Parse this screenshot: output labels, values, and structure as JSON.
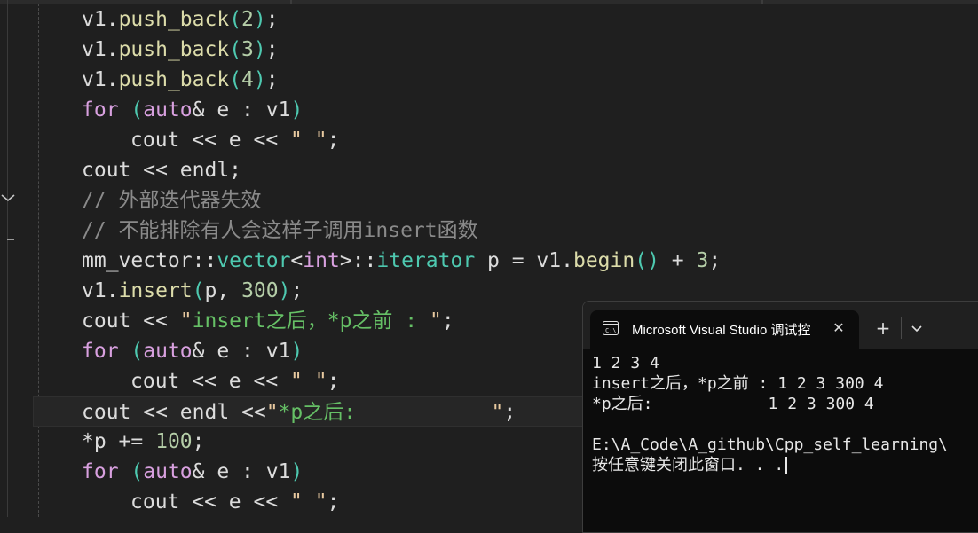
{
  "editor": {
    "lines": [
      {
        "indent": 1,
        "tokens": [
          [
            "v1",
            "c-text"
          ],
          [
            ".",
            "c-text"
          ],
          [
            "push_back",
            "c-fn"
          ],
          [
            "(",
            "c-paren"
          ],
          [
            "2",
            "c-num"
          ],
          [
            ")",
            "c-paren"
          ],
          [
            ";",
            "c-text"
          ]
        ]
      },
      {
        "indent": 1,
        "tokens": [
          [
            "v1",
            "c-text"
          ],
          [
            ".",
            "c-text"
          ],
          [
            "push_back",
            "c-fn"
          ],
          [
            "(",
            "c-paren"
          ],
          [
            "3",
            "c-num"
          ],
          [
            ")",
            "c-paren"
          ],
          [
            ";",
            "c-text"
          ]
        ]
      },
      {
        "indent": 1,
        "tokens": [
          [
            "v1",
            "c-text"
          ],
          [
            ".",
            "c-text"
          ],
          [
            "push_back",
            "c-fn"
          ],
          [
            "(",
            "c-paren"
          ],
          [
            "4",
            "c-num"
          ],
          [
            ")",
            "c-paren"
          ],
          [
            ";",
            "c-text"
          ]
        ]
      },
      {
        "indent": 1,
        "tokens": [
          [
            "for",
            "c-ctl"
          ],
          [
            " ",
            "c-text"
          ],
          [
            "(",
            "c-paren"
          ],
          [
            "auto",
            "c-kw"
          ],
          [
            "& e : v1",
            "c-text"
          ],
          [
            ")",
            "c-paren"
          ]
        ]
      },
      {
        "indent": 2,
        "tokens": [
          [
            "cout",
            "c-text"
          ],
          [
            " << e << ",
            "c-text"
          ],
          [
            "\" \"",
            "c-strq"
          ],
          [
            ";",
            "c-text"
          ]
        ]
      },
      {
        "indent": 1,
        "tokens": [
          [
            "cout",
            "c-text"
          ],
          [
            " << ",
            "c-text"
          ],
          [
            "endl",
            "c-text"
          ],
          [
            ";",
            "c-text"
          ]
        ]
      },
      {
        "indent": 1,
        "tokens": [
          [
            "// 外部迭代器失效",
            "c-cmt"
          ]
        ]
      },
      {
        "indent": 1,
        "tokens": [
          [
            "// 不能排除有人会这样子调用insert函数",
            "c-cmt"
          ]
        ]
      },
      {
        "indent": 1,
        "tokens": [
          [
            "mm_vector",
            "c-text"
          ],
          [
            "::",
            "c-text"
          ],
          [
            "vector",
            "c-type"
          ],
          [
            "<",
            "c-text"
          ],
          [
            "int",
            "c-kw"
          ],
          [
            ">",
            "c-text"
          ],
          [
            "::",
            "c-text"
          ],
          [
            "iterator",
            "c-type"
          ],
          [
            " p = ",
            "c-text"
          ],
          [
            "v1",
            "c-text"
          ],
          [
            ".",
            "c-text"
          ],
          [
            "begin",
            "c-fn"
          ],
          [
            "()",
            "c-paren"
          ],
          [
            " + ",
            "c-text"
          ],
          [
            "3",
            "c-num"
          ],
          [
            ";",
            "c-text"
          ]
        ]
      },
      {
        "indent": 1,
        "tokens": [
          [
            "v1",
            "c-text"
          ],
          [
            ".",
            "c-text"
          ],
          [
            "insert",
            "c-fn"
          ],
          [
            "(",
            "c-paren"
          ],
          [
            "p, ",
            "c-text"
          ],
          [
            "300",
            "c-num"
          ],
          [
            ")",
            "c-paren"
          ],
          [
            ";",
            "c-text"
          ]
        ]
      },
      {
        "indent": 1,
        "tokens": [
          [
            "cout",
            "c-text"
          ],
          [
            " << ",
            "c-text"
          ],
          [
            "\"",
            "c-strq"
          ],
          [
            "insert之后，*p之前 : ",
            "c-strg"
          ],
          [
            "\"",
            "c-strq"
          ],
          [
            ";",
            "c-text"
          ]
        ]
      },
      {
        "indent": 1,
        "tokens": [
          [
            "for",
            "c-ctl"
          ],
          [
            " ",
            "c-text"
          ],
          [
            "(",
            "c-paren"
          ],
          [
            "auto",
            "c-kw"
          ],
          [
            "& e : v1",
            "c-text"
          ],
          [
            ")",
            "c-paren"
          ]
        ]
      },
      {
        "indent": 2,
        "tokens": [
          [
            "cout",
            "c-text"
          ],
          [
            " << e << ",
            "c-text"
          ],
          [
            "\" \"",
            "c-strq"
          ],
          [
            ";",
            "c-text"
          ]
        ]
      },
      {
        "indent": 1,
        "current": true,
        "tokens": [
          [
            "cout",
            "c-text"
          ],
          [
            " << ",
            "c-text"
          ],
          [
            "endl",
            "c-text"
          ],
          [
            " <<",
            "c-text"
          ],
          [
            "\"",
            "c-strq"
          ],
          [
            "*p之后:           ",
            "c-strg"
          ],
          [
            "\"",
            "c-strq"
          ],
          [
            ";",
            "c-text"
          ]
        ]
      },
      {
        "indent": 1,
        "tokens": [
          [
            "*p",
            "c-text"
          ],
          [
            " += ",
            "c-text"
          ],
          [
            "100",
            "c-num"
          ],
          [
            ";",
            "c-text"
          ]
        ]
      },
      {
        "indent": 1,
        "tokens": [
          [
            "for",
            "c-ctl"
          ],
          [
            " ",
            "c-text"
          ],
          [
            "(",
            "c-paren"
          ],
          [
            "auto",
            "c-kw"
          ],
          [
            "& e : v1",
            "c-text"
          ],
          [
            ")",
            "c-paren"
          ]
        ]
      },
      {
        "indent": 2,
        "tokens": [
          [
            "cout",
            "c-text"
          ],
          [
            " << e << ",
            "c-text"
          ],
          [
            "\" \"",
            "c-strq"
          ],
          [
            ";",
            "c-text"
          ]
        ]
      }
    ]
  },
  "console": {
    "tab_title": "Microsoft Visual Studio 调试控",
    "close_glyph": "✕",
    "new_tab_glyph": "+",
    "output_lines": [
      "1 2 3 4",
      "insert之后，*p之前 : 1 2 3 300 4",
      "*p之后:            1 2 3 300 4",
      "",
      "E:\\A_Code\\A_github\\Cpp_self_learning\\",
      "按任意键关闭此窗口. . ."
    ]
  }
}
